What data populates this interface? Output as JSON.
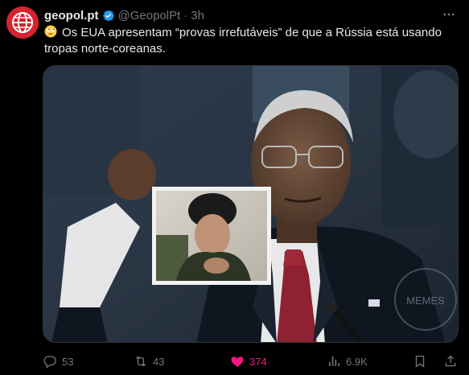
{
  "post": {
    "author_name": "geopol.pt",
    "author_handle": "@GeopolPt",
    "separator": "·",
    "time": "3h",
    "emoji": "face-with-rolling-eyes",
    "text": "Os EUA apresentam “provas irrefutáveis” de que a Rússia está usando tropas norte-coreanas.",
    "verified": true,
    "brand_color": "#d5232f"
  },
  "media": {
    "watermark": "MEMES"
  },
  "actions": {
    "replies": "53",
    "reposts": "43",
    "likes": "374",
    "views": "6.9K",
    "like_color": "#f91880"
  }
}
